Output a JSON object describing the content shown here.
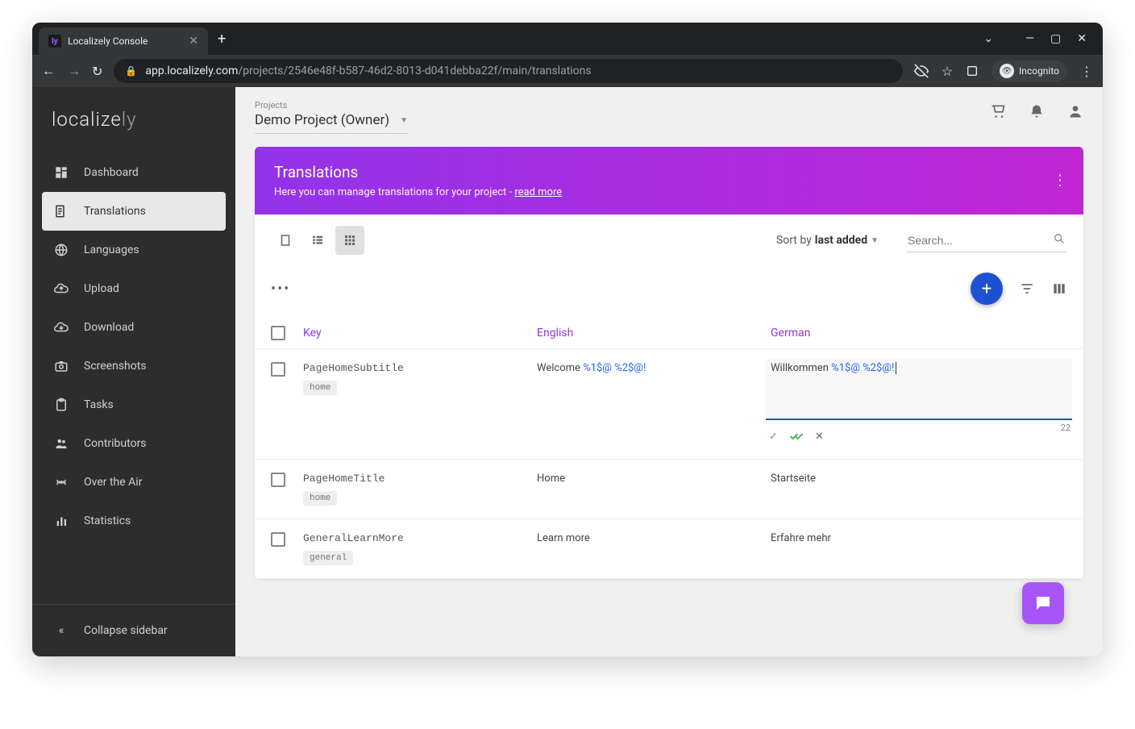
{
  "browser": {
    "tab_title": "Localizely Console",
    "url_domain": "app.localizely.com",
    "url_path": "/projects/2546e48f-b587-46d2-8013-d041debba22f/main/translations",
    "incognito_label": "Incognito"
  },
  "logo": {
    "part1": "localize",
    "part2": "ly"
  },
  "sidebar": {
    "items": [
      {
        "label": "Dashboard"
      },
      {
        "label": "Translations"
      },
      {
        "label": "Languages"
      },
      {
        "label": "Upload"
      },
      {
        "label": "Download"
      },
      {
        "label": "Screenshots"
      },
      {
        "label": "Tasks"
      },
      {
        "label": "Contributors"
      },
      {
        "label": "Over the Air"
      },
      {
        "label": "Statistics"
      }
    ],
    "collapse": "Collapse sidebar"
  },
  "topbar": {
    "projects_label": "Projects",
    "project_name": "Demo Project (Owner)"
  },
  "banner": {
    "title": "Translations",
    "subtitle_prefix": "Here you can manage translations for your project - ",
    "read_more": "read more"
  },
  "toolbar": {
    "sort_prefix": "Sort by ",
    "sort_value": "last added",
    "search_placeholder": "Search..."
  },
  "table": {
    "headers": {
      "key": "Key",
      "en": "English",
      "de": "German"
    },
    "rows": [
      {
        "key": "PageHomeSubtitle",
        "tag": "home",
        "en_prefix": "Welcome ",
        "en_ph": "%1$@ %2$@!",
        "de_prefix": "Willkommen ",
        "de_ph": "%1$@ %2$@!",
        "editing": true,
        "char_count": "22"
      },
      {
        "key": "PageHomeTitle",
        "tag": "home",
        "en": "Home",
        "de": "Startseite"
      },
      {
        "key": "GeneralLearnMore",
        "tag": "general",
        "en": "Learn more",
        "de": "Erfahre mehr"
      }
    ]
  }
}
